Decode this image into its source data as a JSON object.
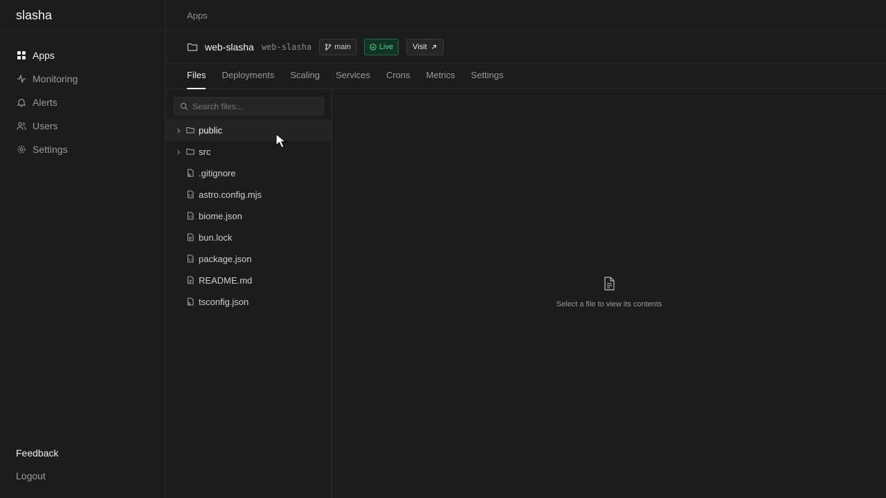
{
  "sidebar": {
    "brand": "slasha",
    "items": [
      {
        "label": "Apps",
        "icon": "grid-icon",
        "active": true
      },
      {
        "label": "Monitoring",
        "icon": "activity-icon",
        "active": false
      },
      {
        "label": "Alerts",
        "icon": "bell-icon",
        "active": false
      },
      {
        "label": "Users",
        "icon": "users-icon",
        "active": false
      },
      {
        "label": "Settings",
        "icon": "gear-icon",
        "active": false
      }
    ],
    "feedback": "Feedback",
    "logout": "Logout"
  },
  "topbar": {
    "breadcrumb": "Apps"
  },
  "app": {
    "name": "web-slasha",
    "slug": "web-slasha",
    "branch": "main",
    "status": "Live",
    "visit_label": "Visit",
    "status_color": "#3ddc8c"
  },
  "tabs": [
    {
      "label": "Files",
      "active": true
    },
    {
      "label": "Deployments"
    },
    {
      "label": "Scaling"
    },
    {
      "label": "Services"
    },
    {
      "label": "Crons"
    },
    {
      "label": "Metrics"
    },
    {
      "label": "Settings"
    }
  ],
  "files": {
    "search_placeholder": "Search files...",
    "items": [
      {
        "name": "public",
        "type": "folder"
      },
      {
        "name": "src",
        "type": "folder"
      },
      {
        "name": ".gitignore",
        "type": "file"
      },
      {
        "name": "astro.config.mjs",
        "type": "file"
      },
      {
        "name": "biome.json",
        "type": "file"
      },
      {
        "name": "bun.lock",
        "type": "file"
      },
      {
        "name": "package.json",
        "type": "file"
      },
      {
        "name": "README.md",
        "type": "file"
      },
      {
        "name": "tsconfig.json",
        "type": "file"
      }
    ]
  },
  "viewer": {
    "empty_message": "Select a file to view its contents"
  }
}
